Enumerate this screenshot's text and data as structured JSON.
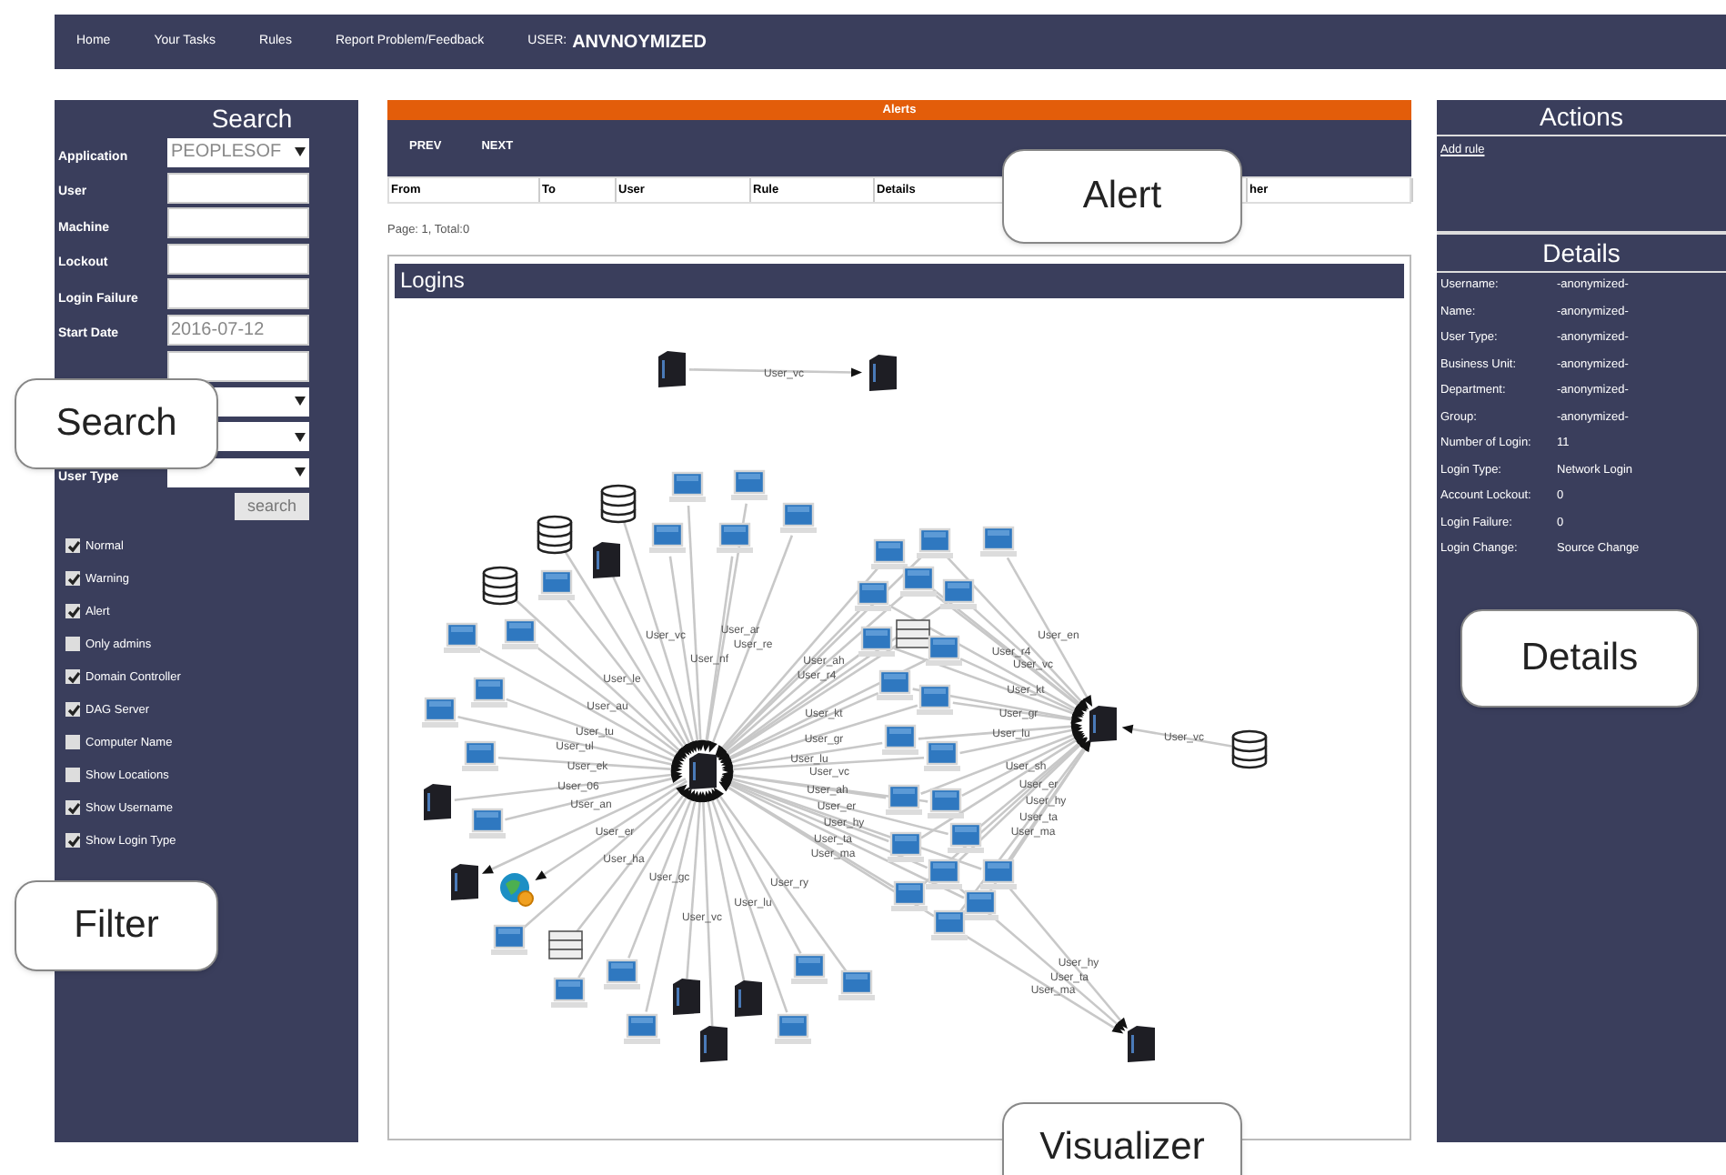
{
  "nav": {
    "items": [
      "Home",
      "Your Tasks",
      "Rules",
      "Report Problem/Feedback"
    ],
    "user_label": "USER:",
    "user_name": "ANVNOYMIZED"
  },
  "search": {
    "title": "Search",
    "fields": [
      {
        "kind": "select",
        "label": "Application",
        "value": "PEOPLESOF"
      },
      {
        "kind": "input",
        "label": "User"
      },
      {
        "kind": "input",
        "label": "Machine"
      },
      {
        "kind": "input",
        "label": "Lockout"
      },
      {
        "kind": "input",
        "label": "Login Failure"
      },
      {
        "kind": "input",
        "label": "Start Date",
        "value": "2016-07-12"
      },
      {
        "kind": "input"
      },
      {
        "kind": "select"
      },
      {
        "kind": "select"
      },
      {
        "kind": "select",
        "label": "User Type"
      }
    ],
    "button": "search",
    "filters": [
      {
        "label": "Normal",
        "checked": true
      },
      {
        "label": "Warning",
        "checked": true
      },
      {
        "label": "Alert",
        "checked": true
      },
      {
        "label": "Only admins",
        "checked": false
      },
      {
        "label": "Domain Controller",
        "checked": true
      },
      {
        "label": "DAG Server",
        "checked": true
      },
      {
        "label": "Computer Name",
        "checked": false
      },
      {
        "label": "Show Locations",
        "checked": false
      },
      {
        "label": "Show Username",
        "checked": true
      },
      {
        "label": "Show Login Type",
        "checked": true
      }
    ]
  },
  "alerts": {
    "title": "Alerts",
    "buttons": [
      "PREV",
      "NEXT"
    ],
    "columns": [
      "From",
      "To",
      "User",
      "Rule",
      "Details",
      "her"
    ],
    "paging": "Page: 1, Total:0"
  },
  "graph": {
    "title": "Logins",
    "pair": [
      {
        "kind": "tower"
      },
      {
        "kind": "tower"
      }
    ],
    "hub_left": {
      "kind": "tower"
    },
    "hub_right": {
      "kind": "tower"
    },
    "hub_bottom": {
      "kind": "tower"
    },
    "groups": [
      {
        "kind": "to_right",
        "nodes": [
          {
            "kind": "database"
          }
        ]
      },
      {
        "kind": "to_left",
        "nodes": [
          {
            "kind": "database"
          },
          {
            "kind": "database"
          },
          {
            "kind": "database"
          },
          {
            "kind": "computer"
          },
          {
            "kind": "computer"
          },
          {
            "kind": "computer"
          },
          {
            "kind": "computer"
          },
          {
            "kind": "computer"
          },
          {
            "kind": "computer"
          },
          {
            "kind": "tower"
          },
          {
            "kind": "computer"
          },
          {
            "kind": "computer"
          },
          {
            "kind": "computer"
          },
          {
            "kind": "computer"
          },
          {
            "kind": "computer"
          },
          {
            "kind": "tower"
          },
          {
            "kind": "computer"
          }
        ]
      },
      {
        "kind": "from_left",
        "nodes": [
          {
            "kind": "tower"
          },
          {
            "kind": "globe"
          }
        ]
      },
      {
        "kind": "to_left",
        "nodes": [
          {
            "kind": "computer"
          },
          {
            "kind": "storage"
          },
          {
            "kind": "computer"
          },
          {
            "kind": "computer"
          },
          {
            "kind": "computer"
          },
          {
            "kind": "tower"
          },
          {
            "kind": "tower"
          },
          {
            "kind": "tower"
          },
          {
            "kind": "computer"
          },
          {
            "kind": "computer"
          },
          {
            "kind": "computer"
          }
        ]
      },
      {
        "kind": "to_both",
        "nodes": [
          {
            "kind": "computer"
          },
          {
            "kind": "computer"
          }
        ]
      },
      {
        "kind": "to_right",
        "nodes": [
          {
            "kind": "computer"
          }
        ]
      },
      {
        "kind": "to_both",
        "nodes": [
          {
            "kind": "computer"
          },
          {
            "kind": "computer"
          },
          {
            "kind": "computer"
          }
        ]
      },
      {
        "kind": "to_left",
        "nodes": [
          {
            "kind": "storage"
          }
        ]
      },
      {
        "kind": "to_both",
        "nodes": [
          {
            "kind": "computer"
          },
          {
            "kind": "computer"
          },
          {
            "kind": "computer"
          },
          {
            "kind": "computer"
          },
          {
            "kind": "computer"
          },
          {
            "kind": "computer"
          },
          {
            "kind": "computer"
          },
          {
            "kind": "computer"
          },
          {
            "kind": "computer"
          },
          {
            "kind": "computer"
          }
        ]
      },
      {
        "kind": "to_all",
        "nodes": [
          {
            "kind": "computer"
          },
          {
            "kind": "computer"
          }
        ]
      },
      {
        "kind": "to_both",
        "nodes": [
          {
            "kind": "computer"
          },
          {
            "kind": "computer"
          }
        ]
      },
      {
        "kind": "to_all",
        "nodes": [
          {
            "kind": "computer"
          }
        ]
      }
    ],
    "edge_labels": [
      "User_vc",
      "User_ar",
      "User_re",
      "User_vc",
      "User_nf",
      "User_le",
      "User_au",
      "User_tu",
      "User_ul",
      "User_ek",
      "User_06",
      "User_an",
      "User_er",
      "User_ha",
      "User_gc",
      "User_ry",
      "User_lu",
      "User_vc",
      "User_ah",
      "User_r4",
      "User_kt",
      "User_gr",
      "User_lu",
      "User_vc",
      "User_ah",
      "User_er",
      "User_hy",
      "User_ta",
      "User_ma",
      "User_en",
      "User_r4",
      "User_vc",
      "User_kt",
      "User_gr",
      "User_lu",
      "User_sh",
      "User_er",
      "User_hy",
      "User_ta",
      "User_ma",
      "User_vc",
      "User_hy",
      "User_ta",
      "User_ma"
    ]
  },
  "actions": {
    "title": "Actions",
    "links": [
      "Add rule"
    ]
  },
  "details": {
    "title": "Details",
    "rows": [
      {
        "label": "Username:",
        "value": "-anonymized-"
      },
      {
        "label": "Name:",
        "value": "-anonymized-"
      },
      {
        "label": "User Type:",
        "value": "-anonymized-"
      },
      {
        "label": "Business Unit:",
        "value": "-anonymized-"
      },
      {
        "label": "Department:",
        "value": "-anonymized-"
      },
      {
        "label": "Group:",
        "value": "-anonymized-"
      },
      {
        "label": "Number of Login:",
        "value": "11"
      },
      {
        "label": "Login Type:",
        "value": "Network Login"
      },
      {
        "label": "Account Lockout:",
        "value": "0"
      },
      {
        "label": "Login Failure:",
        "value": "0"
      },
      {
        "label": "Login Change:",
        "value": "Source Change"
      }
    ]
  },
  "callouts": [
    "Search",
    "Filter",
    "Alert",
    "Details",
    "Visualizer"
  ]
}
